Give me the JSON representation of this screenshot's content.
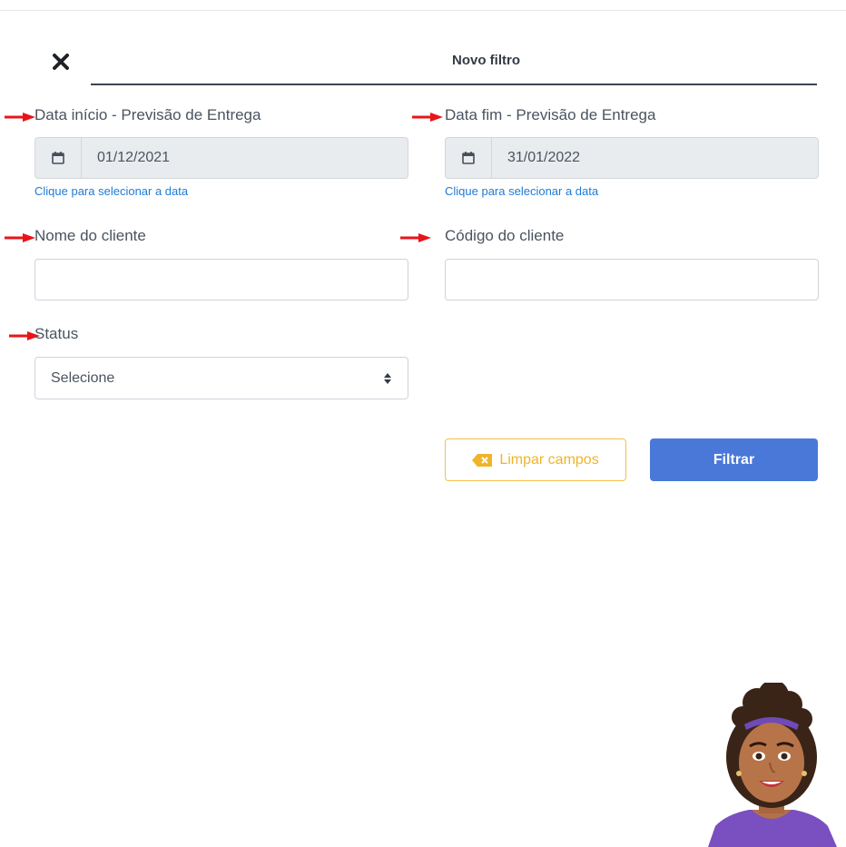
{
  "header": {
    "title": "Novo filtro"
  },
  "fields": {
    "start_date": {
      "label": "Data início - Previsão de Entrega",
      "value": "01/12/2021",
      "hint": "Clique para selecionar a data"
    },
    "end_date": {
      "label": "Data fim - Previsão de Entrega",
      "value": "31/01/2022",
      "hint": "Clique para selecionar a data"
    },
    "client_name": {
      "label": "Nome do cliente",
      "value": "",
      "placeholder": ""
    },
    "client_code": {
      "label": "Código do cliente",
      "value": "",
      "placeholder": ""
    },
    "status": {
      "label": "Status",
      "selected": "Selecione"
    }
  },
  "actions": {
    "clear_label": "Limpar campos",
    "filter_label": "Filtrar"
  },
  "icons": {
    "close": "close-icon",
    "calendar": "calendar-icon",
    "select_arrows": "sort-icon",
    "backspace": "backspace-icon",
    "annotation_arrow": "red-arrow-icon"
  },
  "colors": {
    "link": "#1f7ad6",
    "primary_button": "#4a78d9",
    "clear_button": "#f0b429",
    "annotation_arrow": "#e8141a",
    "readonly_input": "#e9ecef"
  }
}
